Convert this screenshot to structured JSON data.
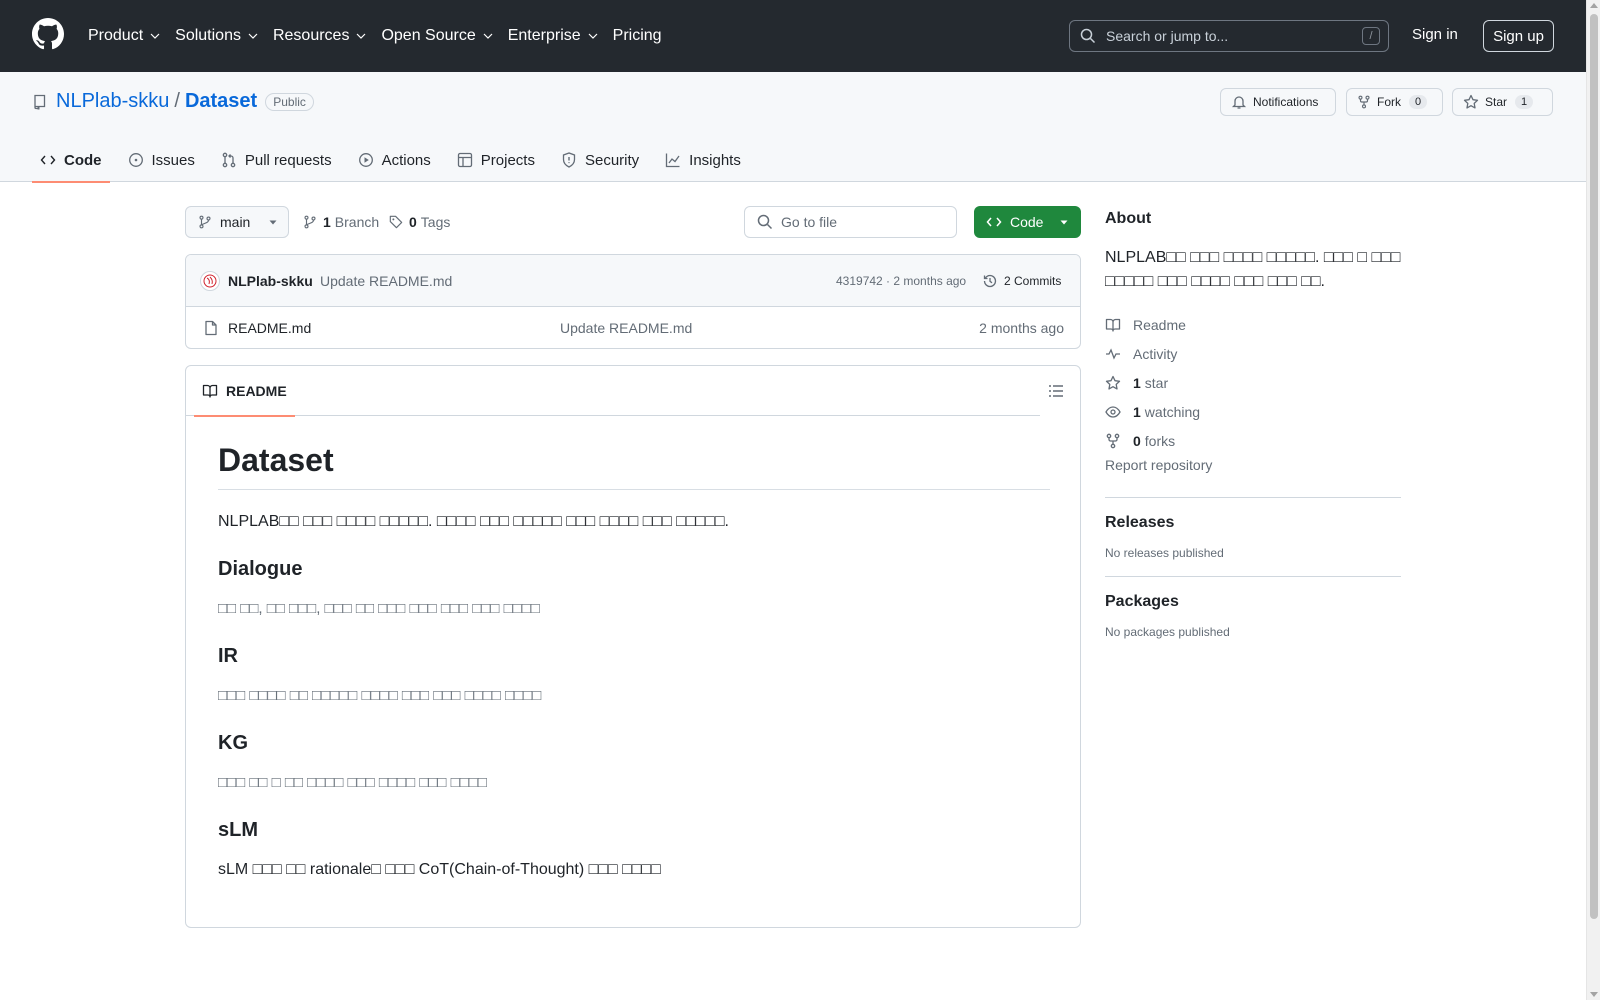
{
  "header": {
    "nav": [
      "Product",
      "Solutions",
      "Resources",
      "Open Source",
      "Enterprise",
      "Pricing"
    ],
    "search_placeholder": "Search or jump to...",
    "search_shortcut": "/",
    "signin": "Sign in",
    "signup": "Sign up"
  },
  "repo": {
    "owner": "NLPlab-skku",
    "separator": "/",
    "name": "Dataset",
    "visibility": "Public",
    "notifications_label": "Notifications",
    "fork_label": "Fork",
    "fork_count": "0",
    "star_label": "Star",
    "star_count": "1"
  },
  "tabs": [
    "Code",
    "Issues",
    "Pull requests",
    "Actions",
    "Projects",
    "Security",
    "Insights"
  ],
  "toolbar": {
    "branch": "main",
    "branch_count": "1",
    "branch_label": "Branch",
    "tag_count": "0",
    "tag_label": "Tags",
    "goto_placeholder": "Go to file",
    "code_button": "Code"
  },
  "last_commit": {
    "author": "NLPlab-skku",
    "message": "Update README.md",
    "hash_time": "4319742 · 2 months ago",
    "commits": "2 Commits"
  },
  "files": [
    {
      "name": "README.md",
      "message": "Update README.md",
      "time": "2 months ago"
    }
  ],
  "readme": {
    "tab_label": "README",
    "title": "Dataset",
    "intro": "NLPLAB□□ □□□ □□□□ □□□□□. □□□□ □□□ □□□□□ □□□ □□□□ □□□ □□□□□.",
    "sections": [
      {
        "heading": "Dialogue",
        "text": "□□ □□, □□ □□□, □□□ □□ □□□ □□□ □□□ □□□ □□□□"
      },
      {
        "heading": "IR",
        "text": "□□□ □□□□ □□ □□□□□ □□□□ □□□ □□□ □□□□ □□□□"
      },
      {
        "heading": "KG",
        "text": "□□□ □□ □ □□ □□□□ □□□ □□□□ □□□ □□□□"
      },
      {
        "heading": "sLM",
        "text": "sLM □□□ □□ rationale□ □□□ CoT(Chain-of-Thought) □□□ □□□□"
      }
    ]
  },
  "about": {
    "title": "About",
    "description": "NLPLAB□□ □□□ □□□□ □□□□□. □□□ □ □□□ □□□□□ □□□ □□□□ □□□ □□□ □□.",
    "readme": "Readme",
    "activity": "Activity",
    "stars_count": "1",
    "stars_label": "star",
    "watching_count": "1",
    "watching_label": "watching",
    "forks_count": "0",
    "forks_label": "forks",
    "report": "Report repository"
  },
  "releases": {
    "title": "Releases",
    "text": "No releases published"
  },
  "packages": {
    "title": "Packages",
    "text": "No packages published"
  },
  "colors": {
    "accent": "#0969da",
    "code_button": "#1f883d",
    "tab_underline": "#fd8c73",
    "header_bg": "#24292f"
  }
}
